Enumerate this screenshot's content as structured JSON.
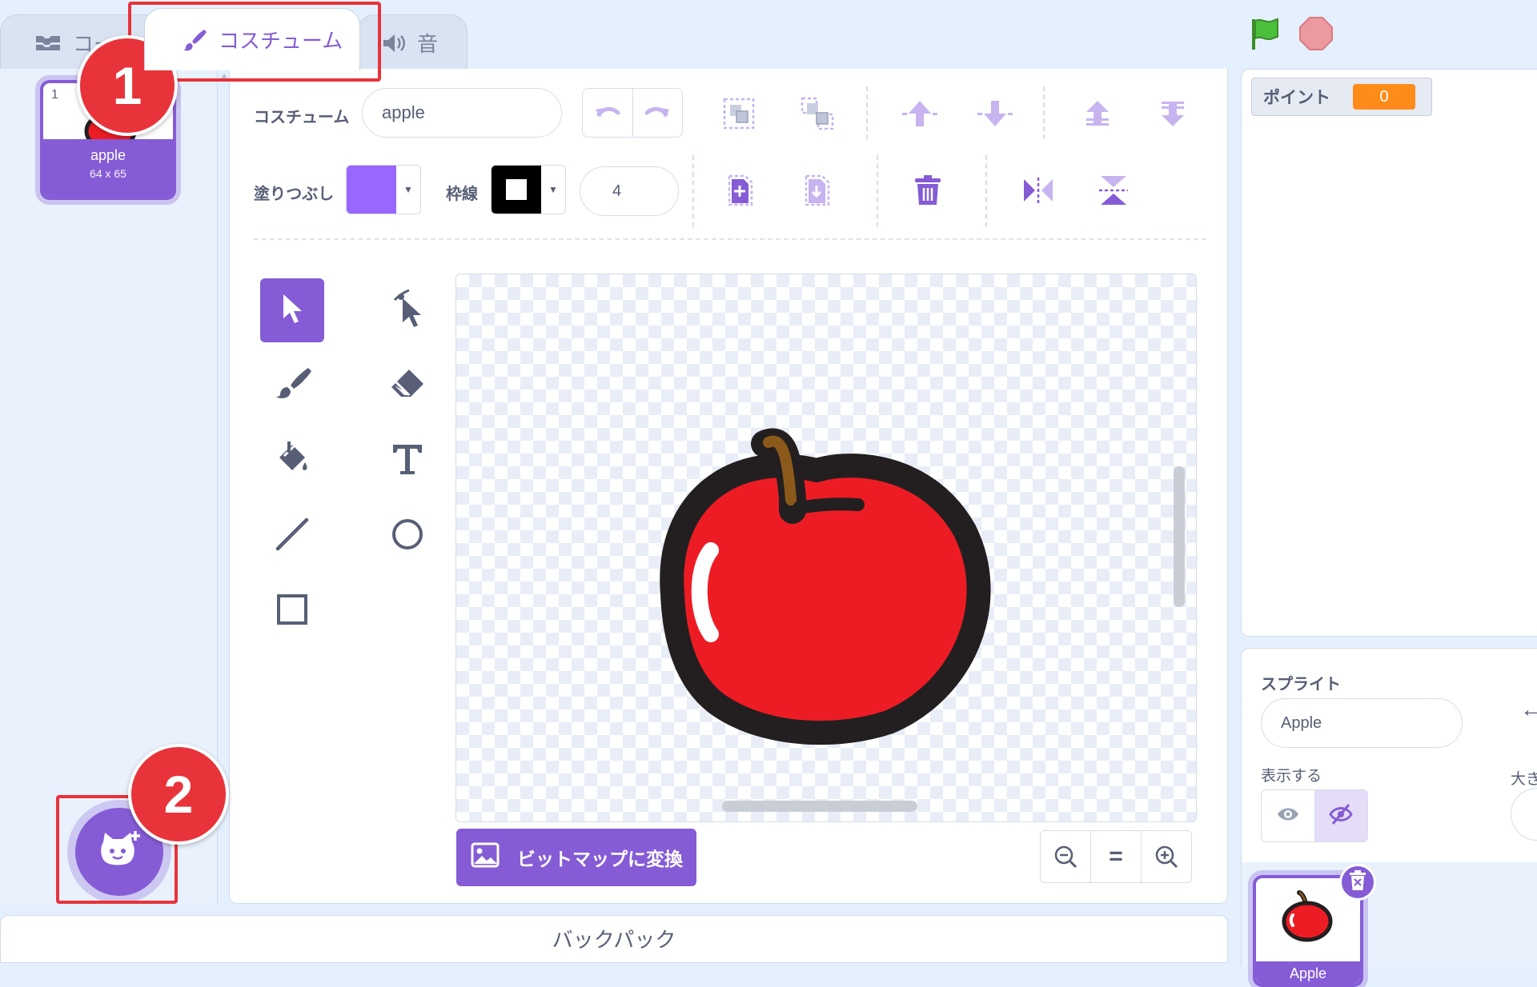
{
  "tabs": [
    {
      "label": "コード",
      "icon": "code-icon"
    },
    {
      "label": "コスチューム",
      "icon": "brush-icon"
    },
    {
      "label": "音",
      "icon": "speaker-icon"
    }
  ],
  "tab_code_visible": "コー",
  "costume_list": {
    "items": [
      {
        "number": "1",
        "name": "apple",
        "size": "64 x 65"
      }
    ],
    "add_button_icon": "add-costume-cat-icon"
  },
  "editor": {
    "costume_label": "コスチューム",
    "costume_name": "apple",
    "fill_label": "塗りつぶし",
    "fill_color": "#9966ff",
    "outline_label": "枠線",
    "outline_color": "#000000",
    "outline_width": "4",
    "convert_button": "ビットマップに変換",
    "zoom_reset": "="
  },
  "toolbar_icons": [
    "undo-icon",
    "redo-icon",
    "group-icon",
    "ungroup-icon",
    "forward-icon",
    "backward-icon",
    "front-icon",
    "back-icon",
    "copy-icon",
    "paste-icon",
    "delete-icon",
    "flip-horizontal-icon",
    "flip-vertical-icon"
  ],
  "tools": [
    "select-tool",
    "reshape-tool",
    "brush-tool",
    "eraser-tool",
    "fill-tool",
    "text-tool",
    "line-tool",
    "circle-tool",
    "rectangle-tool"
  ],
  "backpack": {
    "label": "バックパック"
  },
  "stage": {
    "monitor_label": "ポイント",
    "monitor_value": "0"
  },
  "sprite_info": {
    "section_label": "スプライト",
    "sprite_name": "Apple",
    "show_label": "表示する",
    "size_label_partial": "大き"
  },
  "sprite_pane": {
    "sprite_label": "Apple"
  },
  "annotations": [
    {
      "number": "1",
      "color": "#e8333a"
    },
    {
      "number": "2",
      "color": "#e8333a"
    }
  ],
  "colors": {
    "accent": "#855cd6",
    "highlight": "#e8333a",
    "monitor": "#ff8c1a"
  }
}
